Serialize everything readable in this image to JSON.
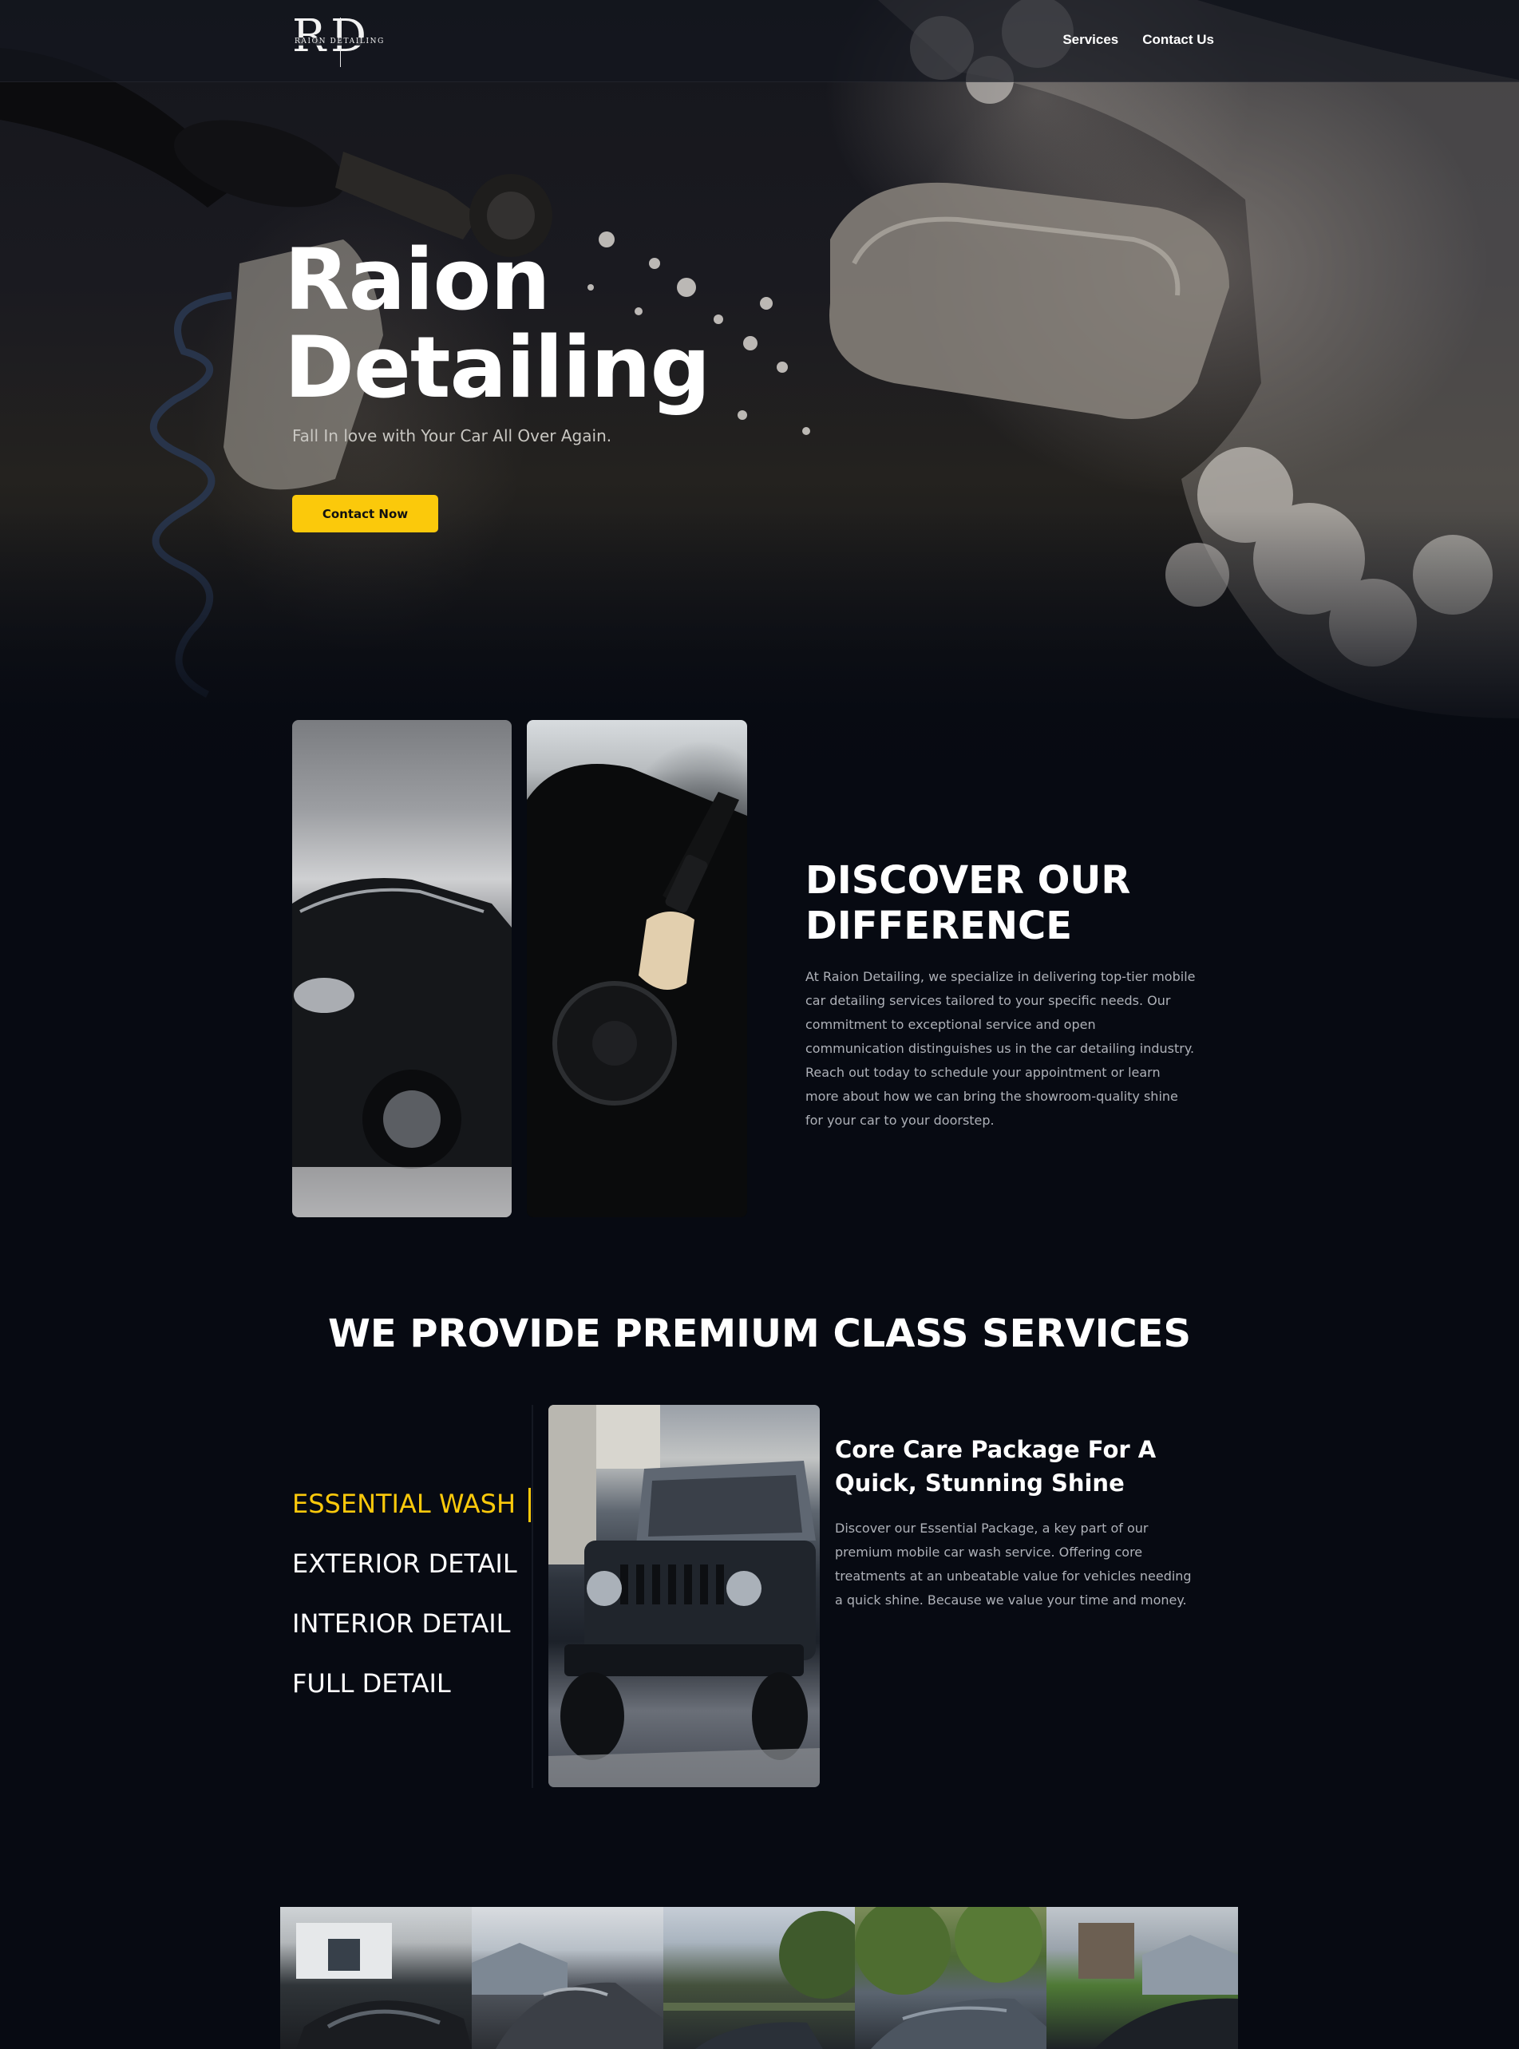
{
  "brand": {
    "logo_letters": "RD",
    "logo_sub": "RAION DETAILING"
  },
  "nav": {
    "items": [
      {
        "label": "Services"
      },
      {
        "label": "Contact Us"
      }
    ]
  },
  "hero": {
    "title_line1": "Raion",
    "title_line2": "Detailing",
    "tagline": "Fall In love with Your Car All Over Again.",
    "cta_label": "Contact Now"
  },
  "discover": {
    "title_line1": "DISCOVER OUR",
    "title_line2": "DIFFERENCE",
    "body": "At Raion Detailing, we specialize in delivering top-tier mobile car detailing services tailored to your specific needs. Our commitment to exceptional service and open communication distinguishes us in the car detailing industry. Reach out today to schedule your appointment or learn more about how we can bring the showroom-quality shine for your car to your doorstep."
  },
  "services": {
    "title": "WE PROVIDE PREMIUM CLASS SERVICES",
    "tabs": [
      {
        "label": "ESSENTIAL WASH"
      },
      {
        "label": "EXTERIOR DETAIL"
      },
      {
        "label": "INTERIOR DETAIL"
      },
      {
        "label": "FULL DETAIL"
      }
    ],
    "active_tab": "ESSENTIAL WASH",
    "package_title": "Core Care Package For A Quick, Stunning Shine",
    "package_body": "Discover our Essential Package, a key part of our premium mobile car wash service. Offering core treatments at an unbeatable value for vehicles needing a quick shine. Because we value your time and money."
  },
  "colors": {
    "accent": "#fbc90b",
    "background": "#070a12",
    "body_text": "#aeb1b8"
  }
}
